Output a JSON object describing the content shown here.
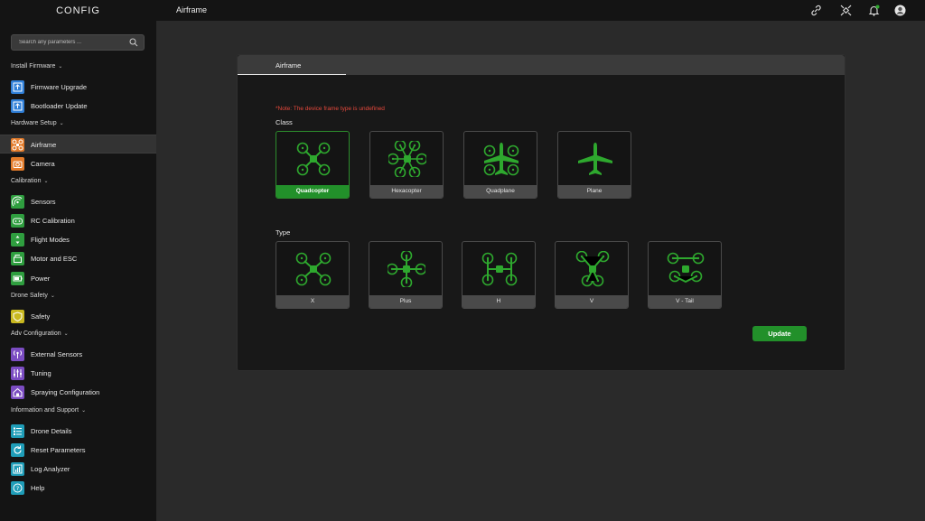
{
  "app": {
    "title": "CONFIG"
  },
  "search": {
    "placeholder": "Search any parameters ..."
  },
  "sidebar": {
    "sections": [
      {
        "label": "Install Firmware",
        "items": [
          {
            "label": "Firmware Upgrade",
            "icon": "upload-icon",
            "color": "#2f7fd8"
          },
          {
            "label": "Bootloader Update",
            "icon": "upload-icon",
            "color": "#2f7fd8"
          }
        ]
      },
      {
        "label": "Hardware Setup",
        "items": [
          {
            "label": "Airframe",
            "icon": "drone-icon",
            "color": "#e37b2a",
            "active": true
          },
          {
            "label": "Camera",
            "icon": "camera-icon",
            "color": "#e37b2a"
          }
        ]
      },
      {
        "label": "Calibration",
        "items": [
          {
            "label": "Sensors",
            "icon": "signal-icon",
            "color": "#2f9e3f"
          },
          {
            "label": "RC Calibration",
            "icon": "gamepad-icon",
            "color": "#2f9e3f"
          },
          {
            "label": "Flight Modes",
            "icon": "updown-icon",
            "color": "#2f9e3f"
          },
          {
            "label": "Motor and ESC",
            "icon": "motor-icon",
            "color": "#2f9e3f"
          },
          {
            "label": "Power",
            "icon": "battery-icon",
            "color": "#2f9e3f"
          }
        ]
      },
      {
        "label": "Drone Safety",
        "items": [
          {
            "label": "Safety",
            "icon": "shield-icon",
            "color": "#c9b820"
          }
        ]
      },
      {
        "label": "Adv Configuration",
        "items": [
          {
            "label": "External Sensors",
            "icon": "antenna-icon",
            "color": "#7b4cc2"
          },
          {
            "label": "Tuning",
            "icon": "sliders-icon",
            "color": "#7b4cc2"
          },
          {
            "label": "Spraying Configuration",
            "icon": "spray-icon",
            "color": "#7b4cc2"
          }
        ]
      },
      {
        "label": "Information and Support",
        "items": [
          {
            "label": "Drone Details",
            "icon": "list-icon",
            "color": "#1f9db8"
          },
          {
            "label": "Reset Parameters",
            "icon": "reset-icon",
            "color": "#1f9db8"
          },
          {
            "label": "Log Analyzer",
            "icon": "chart-icon",
            "color": "#1f9db8"
          },
          {
            "label": "Help",
            "icon": "help-icon",
            "color": "#1f9db8"
          }
        ]
      }
    ]
  },
  "header": {
    "title": "Airframe",
    "icons": [
      "link-icon",
      "satellite-icon",
      "bell-icon",
      "user-icon"
    ]
  },
  "panel": {
    "tab": "Airframe",
    "note": "*Note: The device frame type is undefined",
    "class_label": "Class",
    "classes": [
      {
        "label": "Quadcopter",
        "selected": true
      },
      {
        "label": "Hexacopter",
        "selected": false
      },
      {
        "label": "Quadplane",
        "selected": false
      },
      {
        "label": "Plane",
        "selected": false
      }
    ],
    "type_label": "Type",
    "types": [
      {
        "label": "X"
      },
      {
        "label": "Plus"
      },
      {
        "label": "H"
      },
      {
        "label": "V"
      },
      {
        "label": "V - Tail"
      }
    ],
    "update_label": "Update"
  },
  "colors": {
    "accent": "#22902a",
    "icon_green": "#2ea82e",
    "warning": "#e8493c"
  }
}
